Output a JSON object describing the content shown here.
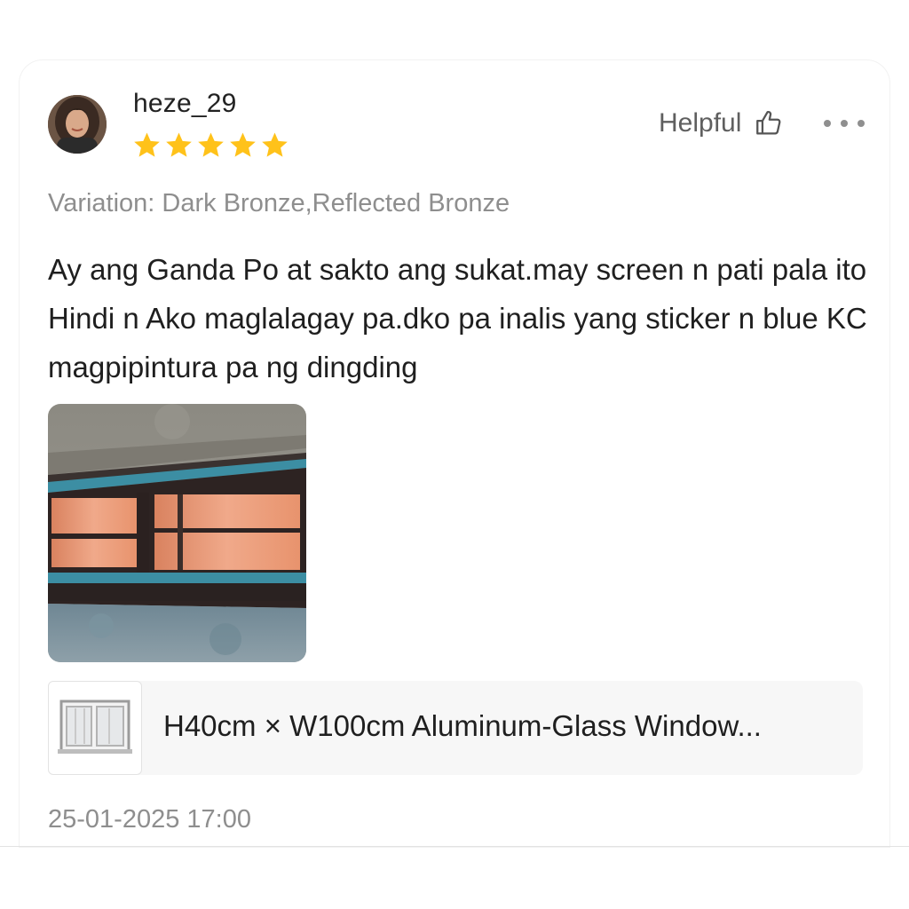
{
  "review": {
    "username": "heze_29",
    "rating": 5,
    "rating_max": 5,
    "helpful_label": "Helpful",
    "variation": "Variation: Dark Bronze,Reflected Bronze",
    "text": "Ay ang Ganda Po at sakto ang sukat.may screen n pati pala ito Hindi n Ako maglalagay pa.dko pa inalis yang sticker n blue KC magpipintura pa ng dingding",
    "timestamp": "25-01-2025 17:00"
  },
  "product": {
    "title": "H40cm × W100cm Aluminum-Glass Window..."
  },
  "icons": {
    "avatar": "user-avatar",
    "star": "star-icon",
    "helpful": "thumbs-up-icon",
    "more": "more-options-icon",
    "photo": "review-photo",
    "product_thumb": "window-icon"
  },
  "colors": {
    "star": "#FFC21A",
    "text_primary": "#1f1f1f",
    "text_secondary": "#8e8e8e",
    "product_bg": "#f7f7f7"
  }
}
